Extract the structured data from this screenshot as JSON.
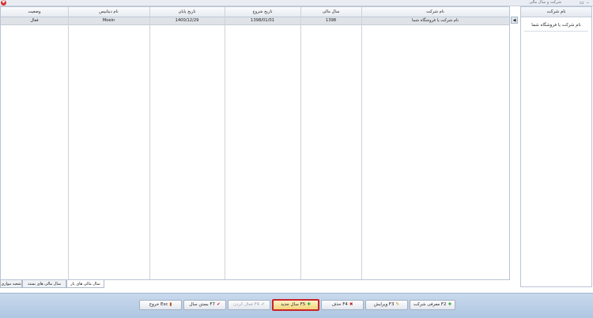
{
  "window": {
    "title": "شرکت و سال مالی"
  },
  "grid": {
    "columns": [
      "وضعیت",
      "نام دیتابیس",
      "تاریخ پایان",
      "تاریخ شروع",
      "سال مالی",
      "نام شرکت"
    ],
    "rows": [
      {
        "status": "فعال",
        "db": "Moein",
        "end": "1400/12/29",
        "start": "1398/01/01",
        "year": "1398",
        "company": "نام شرکت یا فروشگاه شما"
      }
    ]
  },
  "right_panel": {
    "header": "نام شرکت",
    "item": "نام شرکت یا فروشگاه شما"
  },
  "tabs": [
    "سال مالی های باز",
    "سال مالی های بسته",
    "شعبه موازی"
  ],
  "buttons": {
    "set_company": "معرفی شرکت F2",
    "edit": "ویرایش F3",
    "delete": "حذف F4",
    "new_year": "سال جدید F5",
    "activate": "فعال کردن F6",
    "close_year": "بستن سال F7",
    "exit": "خروج Esc"
  },
  "colors": {
    "accent": "#c9232b",
    "bar": "#aec6e2"
  }
}
